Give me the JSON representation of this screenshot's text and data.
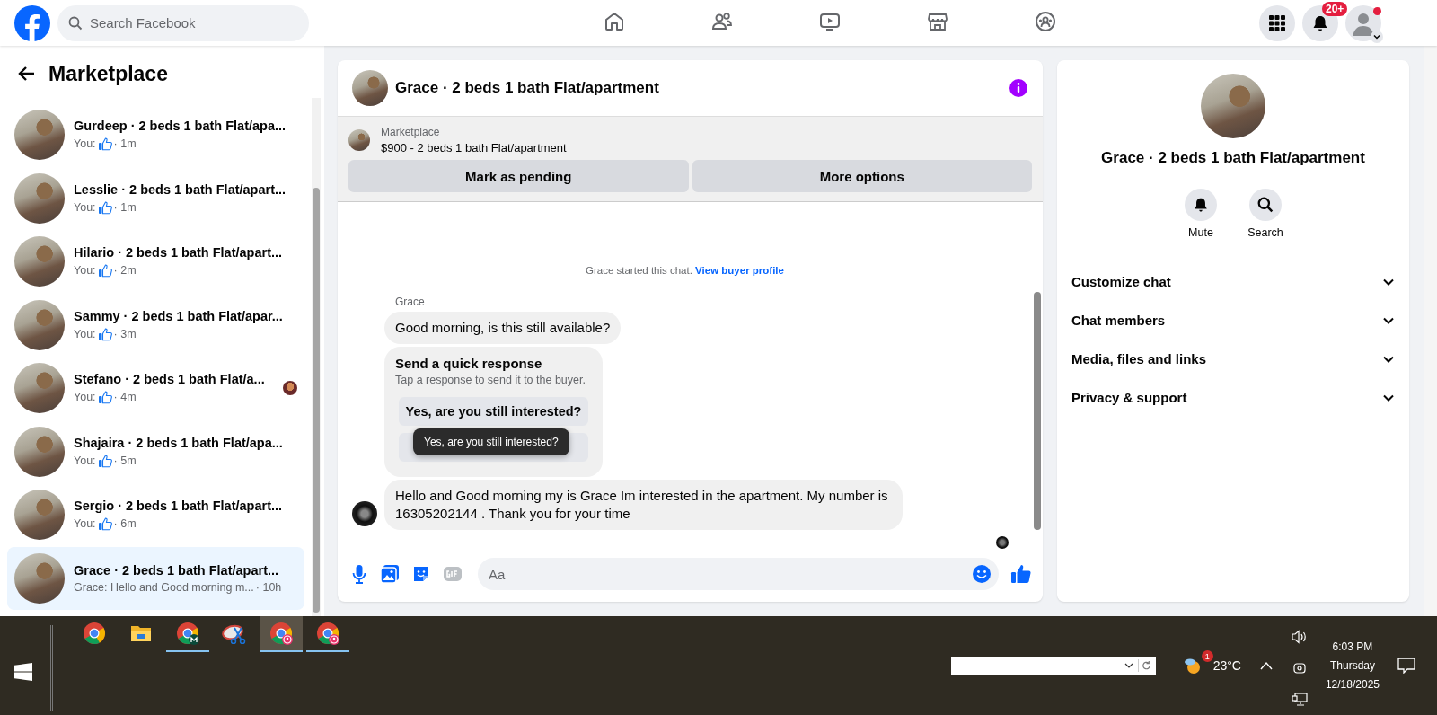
{
  "top_bar": {
    "search": {
      "placeholder": "Search Facebook"
    },
    "nav": [
      {
        "kind": "home",
        "selected": false
      },
      {
        "kind": "friends",
        "selected": false
      },
      {
        "kind": "video",
        "selected": false
      },
      {
        "kind": "marketplace",
        "selected": false
      },
      {
        "kind": "groups",
        "selected": false
      }
    ],
    "notifications_badge": "20+",
    "profile_dot": true
  },
  "sidebar": {
    "title": "Marketplace",
    "conversations": [
      {
        "title": "Gurdeep · 2 beds 1 bath Flat/apa...",
        "preview": "You:",
        "like": true,
        "time": "· 1m",
        "seen_avatar": false,
        "selected": false
      },
      {
        "title": "Lesslie · 2 beds 1 bath Flat/apart...",
        "preview": "You:",
        "like": true,
        "time": "· 1m",
        "seen_avatar": false,
        "selected": false
      },
      {
        "title": "Hilario · 2 beds 1 bath Flat/apart...",
        "preview": "You:",
        "like": true,
        "time": "· 2m",
        "seen_avatar": false,
        "selected": false
      },
      {
        "title": "Sammy · 2 beds 1 bath Flat/apar...",
        "preview": "You:",
        "like": true,
        "time": "· 3m",
        "seen_avatar": false,
        "selected": false
      },
      {
        "title": "Stefano · 2 beds 1 bath Flat/a...",
        "preview": "You:",
        "like": true,
        "time": "· 4m",
        "seen_avatar": true,
        "selected": false
      },
      {
        "title": "Shajaira · 2 beds 1 bath Flat/apa...",
        "preview": "You:",
        "like": true,
        "time": "· 5m",
        "seen_avatar": false,
        "selected": false
      },
      {
        "title": "Sergio · 2 beds 1 bath Flat/apart...",
        "preview": "You:",
        "like": true,
        "time": "· 6m",
        "seen_avatar": false,
        "selected": false
      },
      {
        "title": "Grace · 2 beds 1 bath Flat/apart...",
        "preview": "Grace: Hello and Good morning m...",
        "like": false,
        "time": "· 10h",
        "seen_avatar": false,
        "selected": true
      }
    ]
  },
  "chat": {
    "title": "Grace · 2 beds 1 bath Flat/apartment",
    "listing": {
      "label": "Marketplace",
      "text": "$900 - 2 beds 1 bath Flat/apartment"
    },
    "buttons": [
      "Mark as pending",
      "More options"
    ],
    "note": {
      "text": "Grace started this chat.",
      "link": "View buyer profile"
    },
    "sender": "Grace",
    "messages": [
      {
        "kind": "text",
        "text": "Good morning, is this still available?",
        "avatar": false
      },
      {
        "kind": "quick_response",
        "title": "Send a quick response",
        "subtitle": "Tap a response to send it to the buyer.",
        "options": [
          {
            "kind": "text",
            "text": "Yes, are you still interested?"
          },
          {
            "kind": "covered"
          }
        ],
        "tooltip": "Yes, are you still interested?"
      },
      {
        "kind": "text",
        "text": "Hello and Good morning my is Grace Im interested in the apartment. My number is 16305202144 . Thank you for your time",
        "avatar": true
      }
    ],
    "composer": {
      "placeholder": "Aa"
    }
  },
  "details": {
    "title": "Grace · 2 beds 1 bath Flat/apartment",
    "actions": [
      {
        "kind": "mute",
        "label": "Mute"
      },
      {
        "kind": "search",
        "label": "Search"
      }
    ],
    "sections": [
      {
        "label": "Customize chat",
        "expanded": false
      },
      {
        "label": "Chat members",
        "expanded": false
      },
      {
        "label": "Media, files and links",
        "expanded": false
      },
      {
        "label": "Privacy & support",
        "expanded": false
      }
    ]
  },
  "taskbar": {
    "apps": [
      {
        "kind": "chrome",
        "running": false,
        "selected": false
      },
      {
        "kind": "folder",
        "running": false,
        "selected": false
      },
      {
        "kind": "chrome_m",
        "running": true,
        "selected": false
      },
      {
        "kind": "snip",
        "running": false,
        "selected": false
      },
      {
        "kind": "chrome_profile",
        "running": true,
        "selected": true
      },
      {
        "kind": "chrome_profile",
        "running": true,
        "selected": false
      }
    ],
    "weather": {
      "temp": "23°C",
      "badge": "1"
    },
    "clock": {
      "time": "6:03 PM",
      "day": "Thursday",
      "date": "12/18/2025"
    }
  }
}
